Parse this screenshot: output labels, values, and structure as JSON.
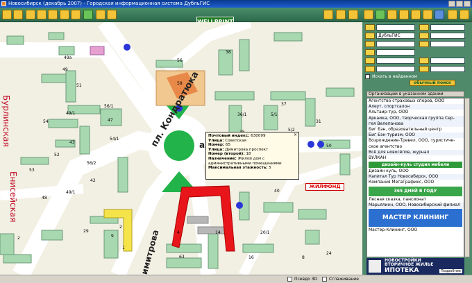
{
  "window": {
    "title": "Новосибирск (декабрь 2007) - Городская информационная система ДубльГИС"
  },
  "toolbar": {
    "brand": "WELLPRINT"
  },
  "map": {
    "street_labels": [
      "Бурлинская",
      "Енисейская",
      "пл. Кондратюка",
      "Димитрова",
      "ая"
    ],
    "house_numbers": [
      "56",
      "49а",
      "49",
      "51",
      "49/1",
      "47",
      "43",
      "58",
      "38",
      "54",
      "36/1",
      "56/1",
      "54/1",
      "56/2",
      "35",
      "52",
      "37",
      "53",
      "5/2",
      "42",
      "31",
      "48",
      "40",
      "49/1",
      "20/1",
      "14",
      "29",
      "1",
      "9",
      "2",
      "4",
      "63",
      "16",
      "8",
      "24",
      "2",
      "5/1",
      "50"
    ],
    "ad_sign": "ЖИЛФОНД"
  },
  "popup": {
    "postal_label": "Почтовый индекс:",
    "postal": "630099",
    "street_label": "Улица:",
    "street": "Советская",
    "number_label": "Номер:",
    "number": "65",
    "street2_label": "Улица:",
    "street2": "Димитрова проспект",
    "number2_label": "Номер (второй):",
    "number2": "18",
    "purpose_label": "Назначение:",
    "purpose": "Жилой дом с административными помещениями",
    "floors_label": "Максимальная этажность:",
    "floors": "5"
  },
  "sidebar": {
    "fields": [
      {
        "label": "ул",
        "value": ""
      },
      {
        "label": "д",
        "value": ""
      },
      {
        "label": "о-ц",
        "value": "ДубльГИС"
      },
      {
        "label": "рб",
        "value": ""
      },
      {
        "label": "тел",
        "value": ""
      },
      {
        "label": "web",
        "value": ""
      },
      {
        "label": "п",
        "value": ""
      }
    ],
    "checkbox_label": "Искать в найденном",
    "search_button": "обычный поиск",
    "panel_header": "Организации в указанном здании",
    "orgs": [
      "Агентство страховых споров, ООО",
      "Алеут, спортсалон",
      "Альтаир-тур, ООО",
      "Аркаика, ООО, творческая группа Сер-",
      "гея Велепанова",
      "Биг Бэн, образовательный центр",
      "Биг Бэн-туризм, ООО",
      "Возрождение-Тревел, ООО, туристиче-",
      "ское агентство",
      "Всё для новосёлов, журнал",
      "ВУЛКАН"
    ],
    "ad1": "дизайн-куль студия мебели",
    "orgs2": [
      "Дизайн куль, ООО",
      "Капитал Тур Новосибирск, ООО",
      "Компания МегаГрафикс, ООО"
    ],
    "ad2": "365 ДНЕЙ В ГОДУ",
    "orgs3": [
      "Лесная сказка, пансионат",
      "Марьялион, ООО, Новосибирский филиал"
    ],
    "ad3": "МАСТЕР КЛИНИНГ",
    "orgs4": [
      "Мастер-Клининг, ООО"
    ],
    "bottom_ad_line1": "НОВОСТРОЙКИ",
    "bottom_ad_line2": "ВТОРИЧНОЕ ЖИЛЬЕ",
    "bottom_ad_line3": "ИПОТЕКА",
    "bottom_ad_more": "Подробнее"
  },
  "status": {
    "pseudo3d": "Псевдо 3D",
    "smooth": "Сглаживание"
  },
  "colors": {
    "map_bg": "#f2efe3",
    "road": "#ffffff",
    "building": "#a8d8b0",
    "red_building": "#e8161a",
    "marker": "#2a36d8"
  }
}
